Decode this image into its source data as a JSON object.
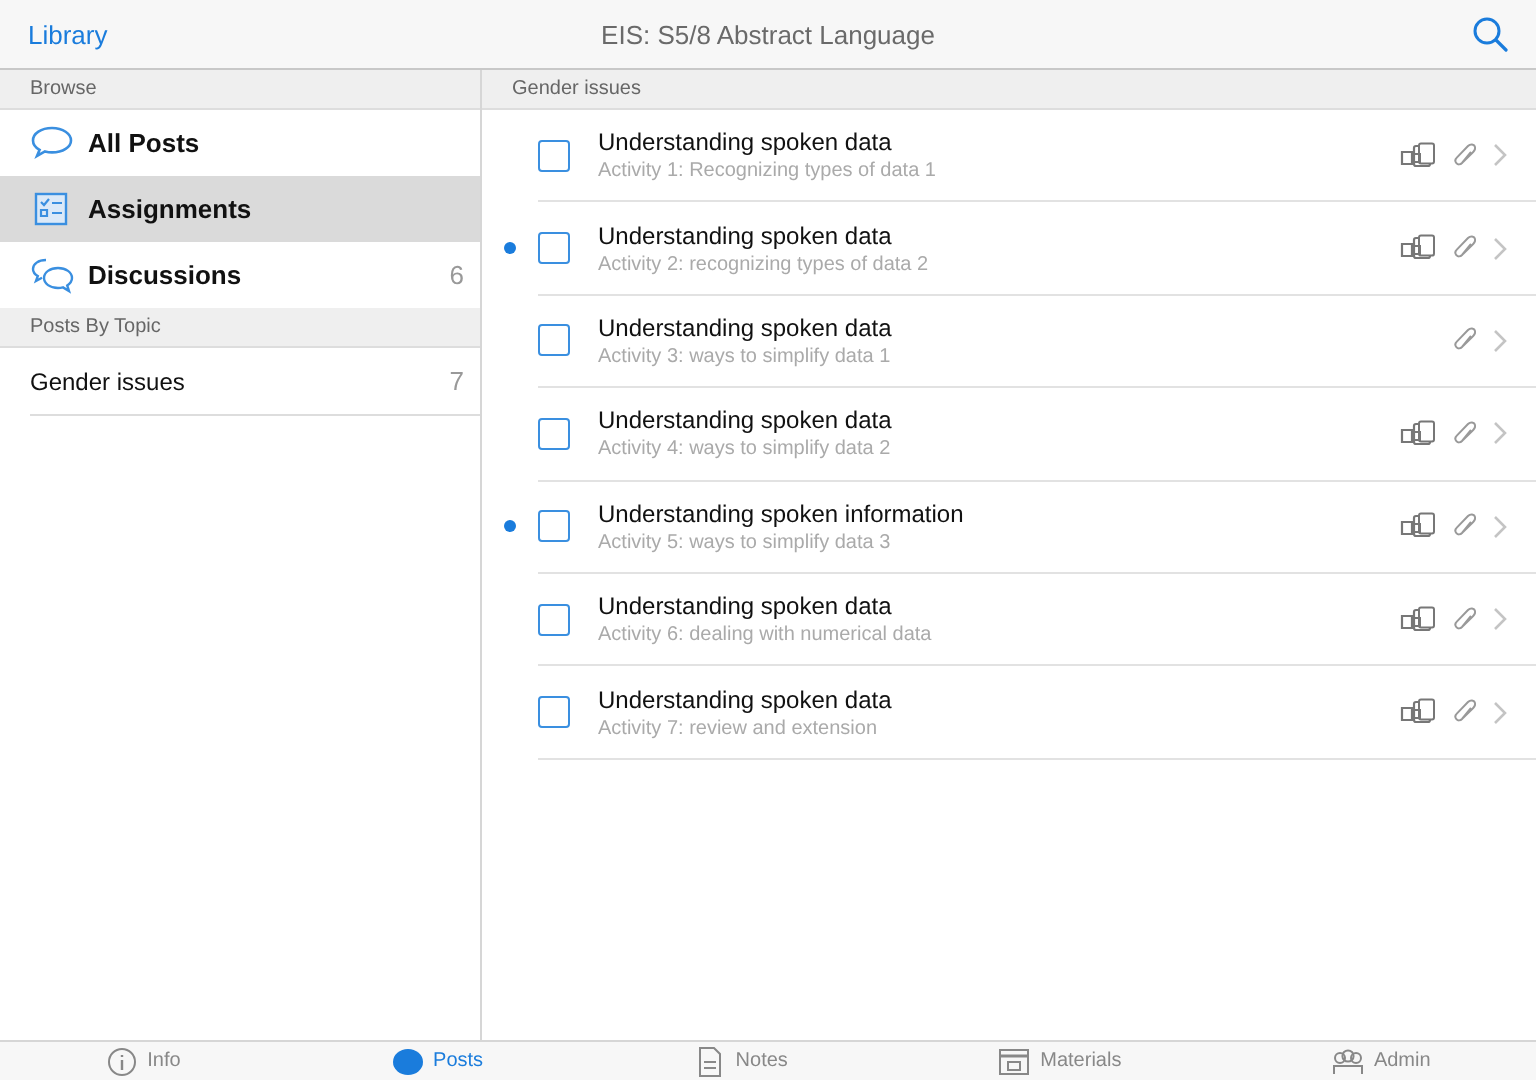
{
  "nav_bar": {
    "back": "Library",
    "title": "EIS: S5/8 Abstract Language"
  },
  "sidebar": {
    "header": "Browse",
    "items": [
      {
        "kind": "all",
        "label": "All Posts",
        "selected": false
      },
      {
        "kind": "assignments",
        "label": "Assignments",
        "selected": true
      },
      {
        "kind": "discussions",
        "label": "Discussions",
        "count": "6",
        "selected": false
      }
    ],
    "topics_header": "Posts By Topic",
    "topics": [
      {
        "label": "Gender issues",
        "count": "7",
        "selected": false
      }
    ]
  },
  "list": {
    "header": "Gender issues",
    "rows": [
      {
        "title": "Understanding spoken data",
        "subtitle": "Activity 1: Recognizing types of data 1",
        "unread": false,
        "checked": false,
        "shared": true,
        "attachment": true
      },
      {
        "title": "Understanding spoken data",
        "subtitle": "Activity 2: recognizing types of data 2",
        "unread": true,
        "checked": false,
        "shared": true,
        "attachment": true
      },
      {
        "title": "Understanding spoken data",
        "subtitle": "Activity 3: ways to simplify data 1",
        "unread": false,
        "checked": false,
        "shared": false,
        "attachment": true
      },
      {
        "title": "Understanding spoken data",
        "subtitle": "Activity 4: ways to simplify data 2",
        "unread": false,
        "checked": false,
        "shared": true,
        "attachment": true
      },
      {
        "title": "Understanding spoken information",
        "subtitle": "Activity 5: ways to simplify data 3",
        "unread": true,
        "checked": false,
        "shared": true,
        "attachment": true
      },
      {
        "title": "Understanding spoken data",
        "subtitle": "Activity 6: dealing with numerical data",
        "unread": false,
        "checked": false,
        "shared": true,
        "attachment": true
      },
      {
        "title": "Understanding spoken data",
        "subtitle": "Activity 7: review and extension",
        "unread": false,
        "checked": false,
        "shared": true,
        "attachment": true
      }
    ]
  },
  "tab_bar": [
    {
      "kind": "info",
      "label": "Info",
      "selected": false
    },
    {
      "kind": "posts",
      "label": "Posts",
      "selected": true
    },
    {
      "kind": "notes",
      "label": "Notes",
      "selected": false
    },
    {
      "kind": "materials",
      "label": "Materials",
      "selected": false
    },
    {
      "kind": "admin",
      "label": "Admin",
      "selected": false
    }
  ]
}
